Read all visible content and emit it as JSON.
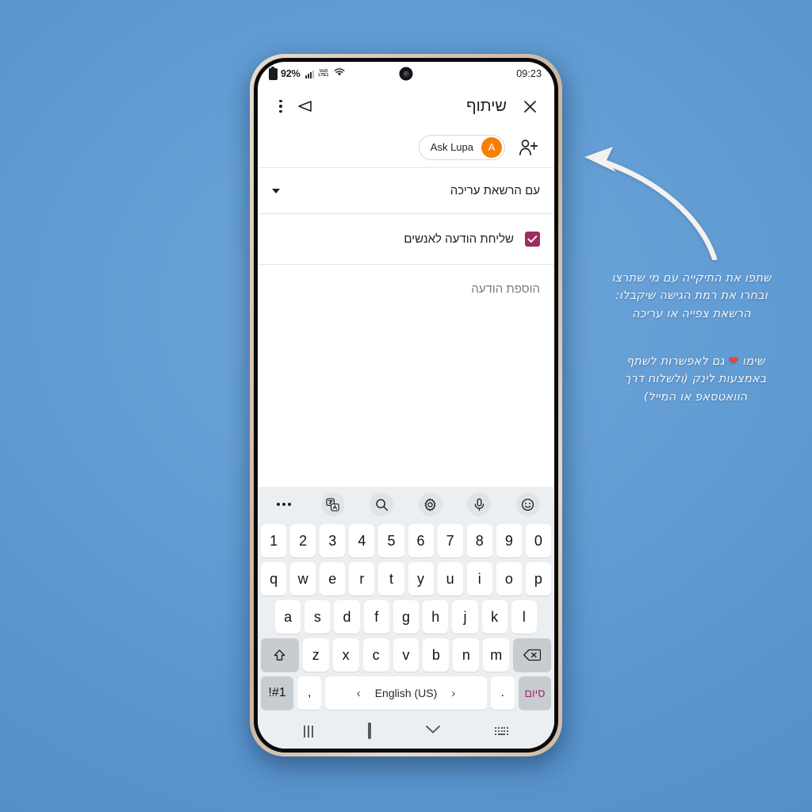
{
  "background": {
    "color": "#5a95cf"
  },
  "phone": {
    "status_bar": {
      "battery_percent": "92%",
      "network_label_top": "VoŊ",
      "network_label_bottom": "LTE1",
      "time": "09:23",
      "icons": [
        "battery-icon",
        "signal-bars-icon",
        "volte-icon",
        "wifi-icon",
        "front-camera-punch-hole"
      ]
    },
    "app_bar": {
      "title": "שיתוף",
      "close_label": "✕",
      "icons": [
        "overflow-menu-icon",
        "undo-icon",
        "close-icon"
      ]
    },
    "action_row": {
      "chip_label": "Ask Lupa",
      "chip_avatar_initial": "A",
      "chip_avatar_color": "#f77f00",
      "add_person_icon": "add-person-icon"
    },
    "rows": [
      {
        "label": "עם הרשאת עריכה",
        "type": "dropdown"
      },
      {
        "label": "שליחת הודעה לאנשים",
        "type": "checkbox",
        "checked": true,
        "accent": "#a02b63"
      }
    ],
    "message_area": {
      "placeholder": "הוספת הודעה",
      "value": ""
    },
    "keyboard": {
      "toolbar": [
        "more-icon",
        "translate-icon",
        "search-icon",
        "settings-icon",
        "microphone-icon",
        "emoji-icon"
      ],
      "rows": {
        "numbers": [
          "1",
          "2",
          "3",
          "4",
          "5",
          "6",
          "7",
          "8",
          "9",
          "0"
        ],
        "top": [
          "q",
          "w",
          "e",
          "r",
          "t",
          "y",
          "u",
          "i",
          "o",
          "p"
        ],
        "home": [
          "a",
          "s",
          "d",
          "f",
          "g",
          "h",
          "j",
          "k",
          "l"
        ],
        "bottom": [
          "z",
          "x",
          "c",
          "v",
          "b",
          "n",
          "m"
        ]
      },
      "shift_icon": "shift-icon",
      "backspace_icon": "backspace-icon",
      "symbols_key": "!#1",
      "comma_key": ",",
      "period_key": ".",
      "space_label": "English (US)",
      "space_prev": "‹",
      "space_next": "›",
      "done_key": "סיום",
      "done_color": "#a02b63"
    },
    "nav_bar": {
      "icons": [
        "recents-icon",
        "home-icon",
        "hide-keyboard-chevron-icon",
        "keyboard-switch-icon"
      ]
    }
  },
  "annotations": {
    "arrow": "curved-arrow-pointing-left",
    "note1": {
      "line1": "שתפו את התיקייה עם מי שתרצו",
      "line2": "ובחרו את רמת הגישה שיקבלו:",
      "line3": "הרשאת צפייה או עריכה"
    },
    "note2": {
      "line1_before": "שימו",
      "heart": "❤",
      "line1_after": "גם לאפשרות לשתף",
      "line2": "באמצעות לינק (ולשלוח דרך",
      "line3": "הוואטסאפ או המייל)"
    }
  }
}
